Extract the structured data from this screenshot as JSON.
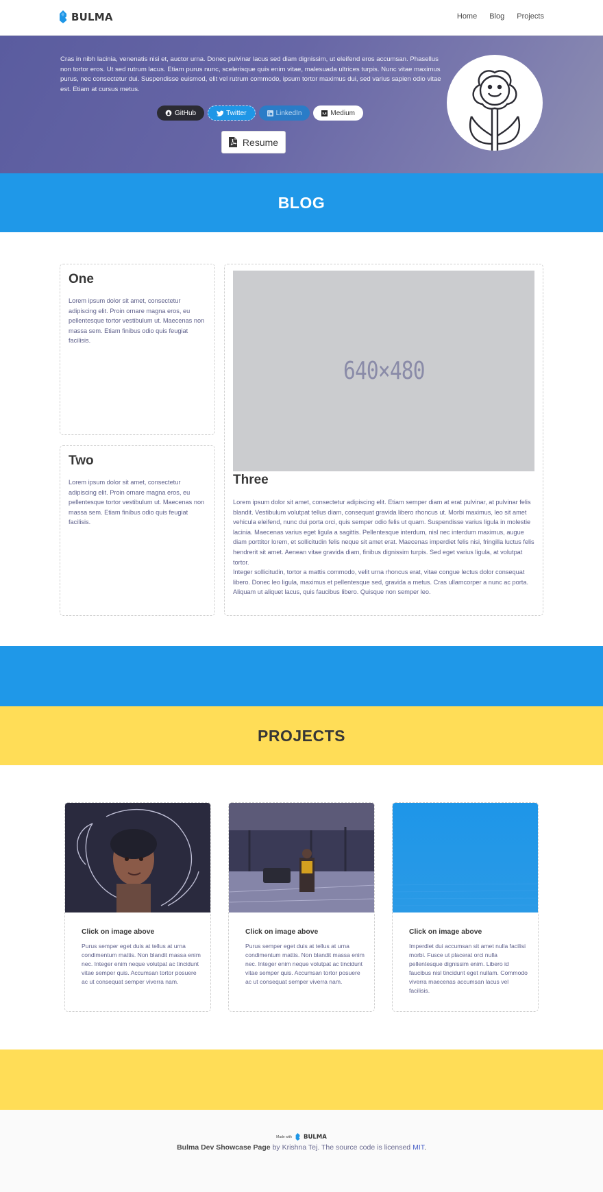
{
  "navbar": {
    "brand": "BULMA",
    "links": [
      "Home",
      "Blog",
      "Projects"
    ]
  },
  "hero": {
    "bio": "Cras in nibh lacinia, venenatis nisi et, auctor urna. Donec pulvinar lacus sed diam dignissim, ut eleifend eros accumsan. Phasellus non tortor eros. Ut sed rutrum lacus. Etiam purus nunc, scelerisque quis enim vitae, malesuada ultrices turpis. Nunc vitae maximus purus, nec consectetur dui. Suspendisse euismod, elit vel rutrum commodo, ipsum tortor maximus dui, sed varius sapien odio vitae est. Etiam at cursus metus.",
    "social": [
      {
        "label": "GitHub",
        "icon": "github-icon"
      },
      {
        "label": "Twitter",
        "icon": "twitter-icon"
      },
      {
        "label": "LinkedIn",
        "icon": "linkedin-icon"
      },
      {
        "label": "Medium",
        "icon": "medium-icon"
      }
    ],
    "resume_label": "Resume",
    "resume_icon": "pdf-file-icon",
    "avatar_icon": "smiling-flower-icon"
  },
  "blog": {
    "title": "BLOG",
    "cards": [
      {
        "title": "One",
        "body": "Lorem ipsum dolor sit amet, consectetur adipiscing elit. Proin ornare magna eros, eu pellentesque tortor vestibulum ut. Maecenas non massa sem. Etiam finibus odio quis feugiat facilisis."
      },
      {
        "title": "Two",
        "body": "Lorem ipsum dolor sit amet, consectetur adipiscing elit. Proin ornare magna eros, eu pellentesque tortor vestibulum ut. Maecenas non massa sem. Etiam finibus odio quis feugiat facilisis."
      },
      {
        "title": "Three",
        "image_label": "640×480",
        "body1": "Lorem ipsum dolor sit amet, consectetur adipiscing elit. Etiam semper diam at erat pulvinar, at pulvinar felis blandit. Vestibulum volutpat tellus diam, consequat gravida libero rhoncus ut. Morbi maximus, leo sit amet vehicula eleifend, nunc dui porta orci, quis semper odio felis ut quam. Suspendisse varius ligula in molestie lacinia. Maecenas varius eget ligula a sagittis. Pellentesque interdum, nisl nec interdum maximus, augue diam porttitor lorem, et sollicitudin felis neque sit amet erat. Maecenas imperdiet felis nisi, fringilla luctus felis hendrerit sit amet. Aenean vitae gravida diam, finibus dignissim turpis. Sed eget varius ligula, at volutpat tortor.",
        "body2": "Integer sollicitudin, tortor a mattis commodo, velit urna rhoncus erat, vitae congue lectus dolor consequat libero. Donec leo ligula, maximus et pellentesque sed, gravida a metus. Cras ullamcorper a nunc ac porta. Aliquam ut aliquet lacus, quis faucibus libero. Quisque non semper leo."
      }
    ]
  },
  "projects": {
    "title": "PROJECTS",
    "cards": [
      {
        "title": "Click on image above",
        "body": "Purus semper eget duis at tellus at urna condimentum mattis. Non blandit massa enim nec. Integer enim neque volutpat ac tincidunt vitae semper quis. Accumsan tortor posuere ac ut consequat semper viverra nam."
      },
      {
        "title": "Click on image above",
        "body": "Purus semper eget duis at tellus at urna condimentum mattis. Non blandit massa enim nec. Integer enim neque volutpat ac tincidunt vitae semper quis. Accumsan tortor posuere ac ut consequat semper viverra nam."
      },
      {
        "title": "Click on image above",
        "body": "Imperdiet dui accumsan sit amet nulla facilisi morbi. Fusce ut placerat orci nulla pellentesque dignissim enim. Libero id faucibus nisl tincidunt eget nullam. Commodo viverra maecenas accumsan lacus vel facilisis."
      }
    ]
  },
  "footer": {
    "made_with": "Made with",
    "brand": "BULMA",
    "site_name": "Bulma Dev Showcase Page",
    "by": "by",
    "author": "Krishna Tej",
    "source_text": ". The source code is licensed",
    "license": "MIT",
    "end": "."
  },
  "colors": {
    "blue_band": "#1f98e8",
    "yellow_band": "#ffdd57",
    "hero_purple": "#6365a3"
  }
}
